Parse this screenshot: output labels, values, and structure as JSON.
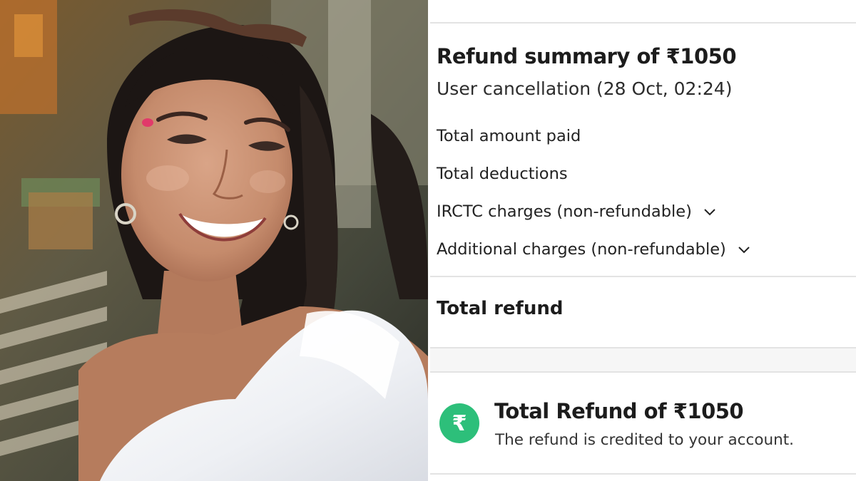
{
  "refund_screen": {
    "title": "Refund summary of ₹1050",
    "subtitle": "User cancellation (28 Oct, 02:24)",
    "rows": [
      {
        "label": "Total amount paid"
      },
      {
        "label": "Total deductions"
      },
      {
        "label": "IRCTC charges (non-refundable)",
        "icon": "chevron-down-icon"
      },
      {
        "label": "Additional charges (non-refundable)",
        "icon": "chevron-down-icon"
      }
    ],
    "total_refund_label": "Total refund",
    "summary_card": {
      "icon": "rupee-icon",
      "icon_glyph": "₹",
      "title": "Total Refund of ₹1050",
      "message": "The refund is credited to your account.",
      "icon_color": "#2dbf7a"
    }
  }
}
